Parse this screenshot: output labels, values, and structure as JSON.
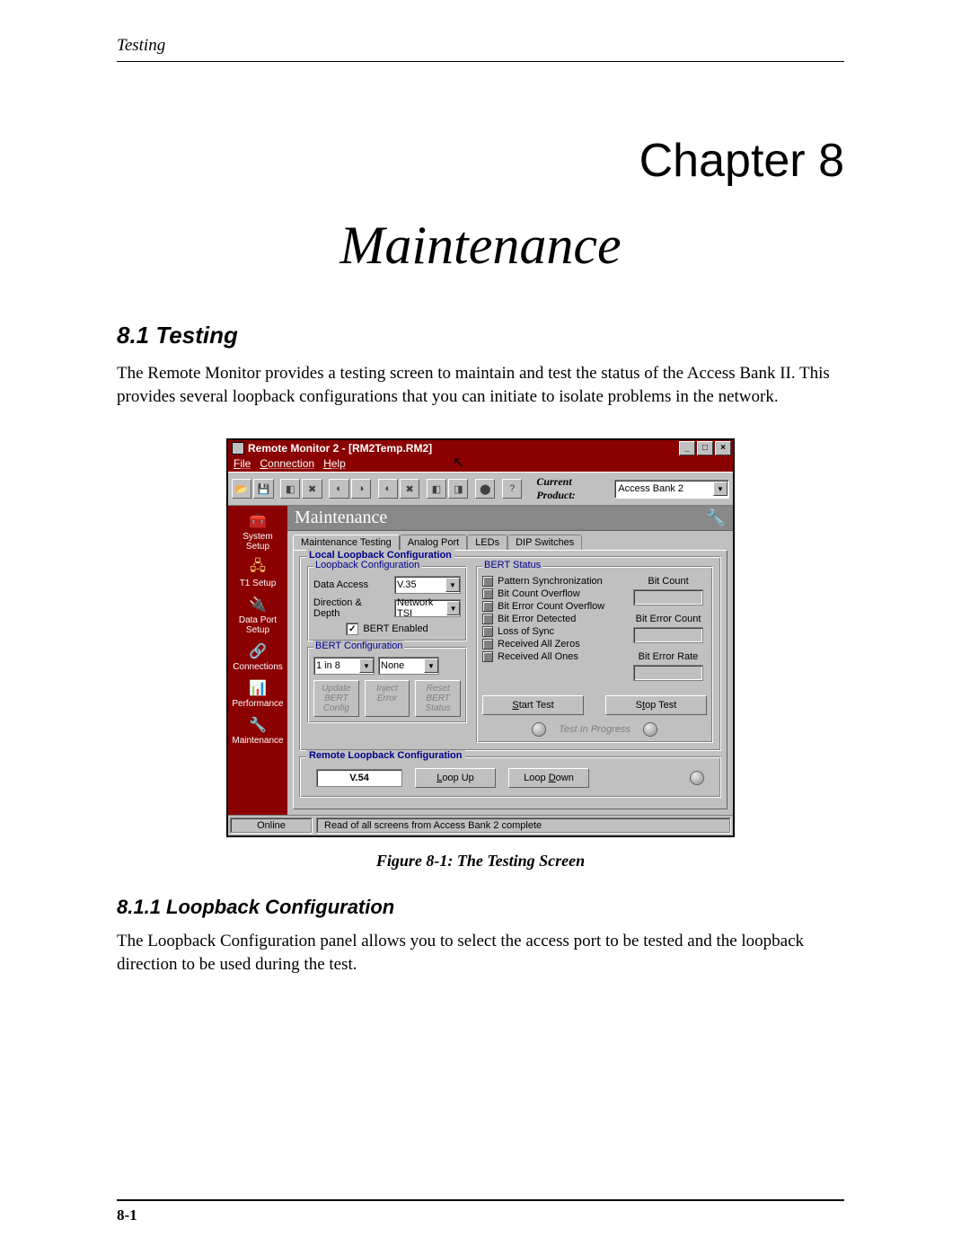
{
  "doc": {
    "running_head": "Testing",
    "chapter_number": "Chapter 8",
    "chapter_title": "Maintenance",
    "section_8_1_head": "8.1  Testing",
    "section_8_1_body": "The Remote Monitor provides a testing screen to maintain and test the status of the Access Bank II. This provides several loopback configurations that you can initiate to isolate problems in the network.",
    "figure_caption": "Figure 8-1: The Testing Screen",
    "section_8_1_1_head": "8.1.1  Loopback Configuration",
    "section_8_1_1_body": "The Loopback Configuration panel allows you to select the access port to be tested and the loopback direction to be used during the test.",
    "page_number": "8-1"
  },
  "app": {
    "title": "Remote Monitor 2 - [RM2Temp.RM2]",
    "menus": [
      "File",
      "Connection",
      "Help"
    ],
    "toolbar": {
      "current_product_label": "Current Product:",
      "current_product_value": "Access Bank 2"
    },
    "sidebar": [
      {
        "label": "System Setup"
      },
      {
        "label": "T1 Setup"
      },
      {
        "label": "Data Port Setup"
      },
      {
        "label": "Connections"
      },
      {
        "label": "Performance"
      },
      {
        "label": "Maintenance"
      }
    ],
    "page_title": "Maintenance",
    "tabs": [
      "Maintenance Testing",
      "Analog Port",
      "LEDs",
      "DIP Switches"
    ],
    "local": {
      "group_title": "Local Loopback Configuration",
      "loopback": {
        "title": "Loopback Configuration",
        "data_access_label": "Data Access",
        "data_access_value": "V.35",
        "direction_label": "Direction & Depth",
        "direction_value": "Network TSI",
        "bert_enabled_label": "BERT Enabled"
      },
      "bert_config": {
        "title": "BERT Configuration",
        "pattern_value": "1 in 8",
        "err_value": "None",
        "btn_update": "Update BERT Config",
        "btn_inject": "Inject Error",
        "btn_reset": "Reset BERT Status"
      },
      "bert_status": {
        "title": "BERT Status",
        "items": [
          "Pattern Synchronization",
          "Bit Count Overflow",
          "Bit Error Count Overflow",
          "Bit Error Detected",
          "Loss of Sync",
          "Received All Zeros",
          "Received All Ones"
        ],
        "counts": {
          "bit_count": "Bit Count",
          "bit_error_count": "Bit Error Count",
          "bit_error_rate": "Bit Error Rate"
        },
        "start_test": "Start Test",
        "stop_test": "Stop Test",
        "progress": "Test In Progress"
      }
    },
    "remote": {
      "group_title": "Remote Loopback Configuration",
      "value": "V.54",
      "loop_up": "Loop Up",
      "loop_down": "Loop Down"
    },
    "status": {
      "left": "Online",
      "right": "Read of all screens from Access Bank 2 complete"
    }
  }
}
